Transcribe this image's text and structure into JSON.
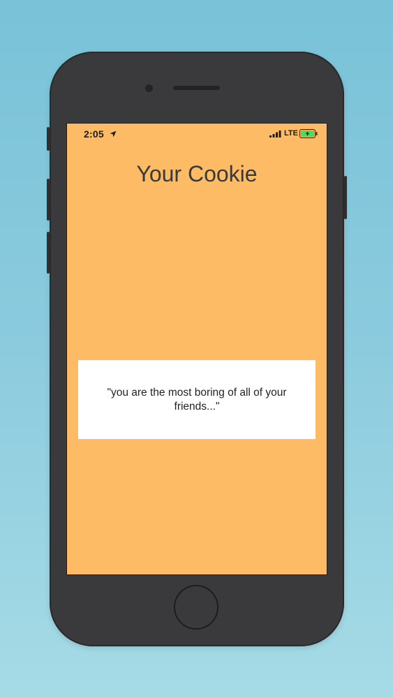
{
  "app": {
    "title": "Your Cookie",
    "background_color": "#fcbb64",
    "card_color": "#ffffff"
  },
  "status_bar": {
    "time": "2:05",
    "network": "LTE",
    "icons": [
      "location-arrow-icon",
      "cellular-signal-icon",
      "battery-charging-icon"
    ],
    "battery_color": "#4cd964"
  },
  "fortune": {
    "text": "\"you are the most boring of all of your friends...\""
  },
  "device": {
    "frame_color": "#3a3a3c"
  }
}
